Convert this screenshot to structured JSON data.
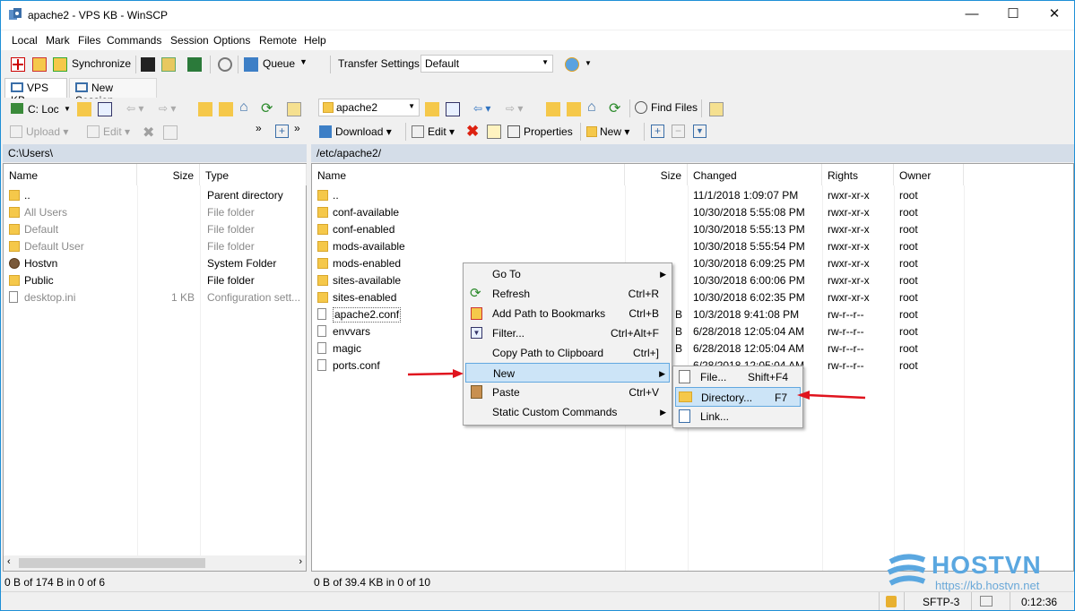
{
  "window": {
    "title": "apache2 - VPS KB - WinSCP",
    "minimize": "—",
    "maximize": "☐",
    "close": "✕"
  },
  "menu": [
    "Local",
    "Mark",
    "Files",
    "Commands",
    "Session",
    "Options",
    "Remote",
    "Help"
  ],
  "toolbar": {
    "synchronize": "Synchronize",
    "queue": "Queue",
    "transfer_label": "Transfer Settings",
    "transfer_value": "Default"
  },
  "tabs": {
    "session": "VPS KB",
    "new_session": "New Session"
  },
  "left": {
    "drive": "C: Loc",
    "upload": "Upload",
    "edit": "Edit",
    "path": "C:\\Users\\",
    "columns": [
      "Name",
      "Size",
      "Type"
    ],
    "rows": [
      {
        "name": "..",
        "size": "",
        "type": "Parent directory",
        "grey": false,
        "kind": "up"
      },
      {
        "name": "All Users",
        "size": "",
        "type": "File folder",
        "grey": true,
        "kind": "folder"
      },
      {
        "name": "Default",
        "size": "",
        "type": "File folder",
        "grey": true,
        "kind": "folder"
      },
      {
        "name": "Default User",
        "size": "",
        "type": "File folder",
        "grey": true,
        "kind": "folder"
      },
      {
        "name": "Hostvn",
        "size": "",
        "type": "System Folder",
        "grey": false,
        "kind": "user"
      },
      {
        "name": "Public",
        "size": "",
        "type": "File folder",
        "grey": false,
        "kind": "folder"
      },
      {
        "name": "desktop.ini",
        "size": "1 KB",
        "type": "Configuration sett...",
        "grey": true,
        "kind": "file"
      }
    ],
    "status": "0 B of 174 B in 0 of 6"
  },
  "right": {
    "dir": "apache2",
    "find": "Find Files",
    "download": "Download",
    "edit": "Edit",
    "properties": "Properties",
    "new": "New",
    "path": "/etc/apache2/",
    "columns": [
      "Name",
      "Size",
      "Changed",
      "Rights",
      "Owner"
    ],
    "rows": [
      {
        "name": "..",
        "size": "",
        "changed": "11/1/2018 1:09:07 PM",
        "rights": "rwxr-xr-x",
        "owner": "root",
        "kind": "up"
      },
      {
        "name": "conf-available",
        "size": "",
        "changed": "10/30/2018 5:55:08 PM",
        "rights": "rwxr-xr-x",
        "owner": "root",
        "kind": "folder"
      },
      {
        "name": "conf-enabled",
        "size": "",
        "changed": "10/30/2018 5:55:13 PM",
        "rights": "rwxr-xr-x",
        "owner": "root",
        "kind": "folder"
      },
      {
        "name": "mods-available",
        "size": "",
        "changed": "10/30/2018 5:55:54 PM",
        "rights": "rwxr-xr-x",
        "owner": "root",
        "kind": "folder"
      },
      {
        "name": "mods-enabled",
        "size": "",
        "changed": "10/30/2018 6:09:25 PM",
        "rights": "rwxr-xr-x",
        "owner": "root",
        "kind": "folder"
      },
      {
        "name": "sites-available",
        "size": "",
        "changed": "10/30/2018 6:00:06 PM",
        "rights": "rwxr-xr-x",
        "owner": "root",
        "kind": "folder"
      },
      {
        "name": "sites-enabled",
        "size": "",
        "changed": "10/30/2018 6:02:35 PM",
        "rights": "rwxr-xr-x",
        "owner": "root",
        "kind": "folder"
      },
      {
        "name": "apache2.conf",
        "size": "B",
        "changed": "10/3/2018 9:41:08 PM",
        "rights": "rw-r--r--",
        "owner": "root",
        "kind": "file"
      },
      {
        "name": "envvars",
        "size": "B",
        "changed": "6/28/2018 12:05:04 AM",
        "rights": "rw-r--r--",
        "owner": "root",
        "kind": "file"
      },
      {
        "name": "magic",
        "size": "B",
        "changed": "6/28/2018 12:05:04 AM",
        "rights": "rw-r--r--",
        "owner": "root",
        "kind": "file"
      },
      {
        "name": "ports.conf",
        "size": "",
        "changed": "6/28/2018 12:05:04 AM",
        "rights": "rw-r--r--",
        "owner": "root",
        "kind": "file"
      }
    ],
    "status": "0 B of 39.4 KB in 0 of 10"
  },
  "context_menu": [
    {
      "label": "Go To",
      "shortcut": "",
      "arrow": "▶"
    },
    {
      "label": "Refresh",
      "shortcut": "Ctrl+R",
      "arrow": ""
    },
    {
      "label": "Add Path to Bookmarks",
      "shortcut": "Ctrl+B",
      "arrow": ""
    },
    {
      "label": "Filter...",
      "shortcut": "Ctrl+Alt+F",
      "arrow": ""
    },
    {
      "label": "Copy Path to Clipboard",
      "shortcut": "Ctrl+]",
      "arrow": ""
    },
    {
      "label": "New",
      "shortcut": "",
      "arrow": "▶"
    },
    {
      "label": "Paste",
      "shortcut": "Ctrl+V",
      "arrow": ""
    },
    {
      "label": "Static Custom Commands",
      "shortcut": "",
      "arrow": "▶"
    }
  ],
  "submenu": [
    {
      "label": "File...",
      "shortcut": "Shift+F4"
    },
    {
      "label": "Directory...",
      "shortcut": "F7"
    },
    {
      "label": "Link...",
      "shortcut": ""
    }
  ],
  "statusbar": {
    "protocol": "SFTP-3",
    "time": "0:12:36"
  },
  "watermark": {
    "brand": "HOSTVN",
    "url": "https://kb.hostvn.net"
  },
  "colors": {
    "accent": "#0078d7",
    "highlight": "#cce4f7",
    "arrow": "#e0141e",
    "folder": "#f5c84a"
  }
}
